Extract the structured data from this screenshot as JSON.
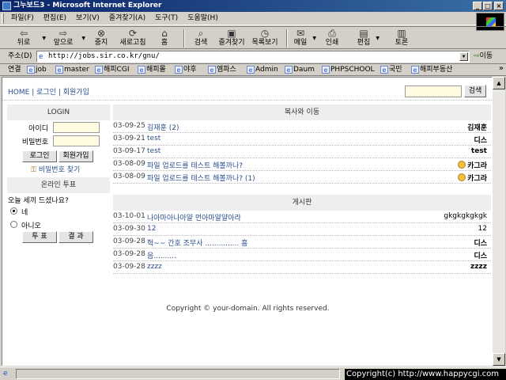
{
  "window": {
    "title": "그누보드3 - Microsoft Internet Explorer"
  },
  "menu": [
    "파일(F)",
    "편집(E)",
    "보기(V)",
    "즐겨찾기(A)",
    "도구(T)",
    "도움말(H)"
  ],
  "toolbar": {
    "back": "뒤로",
    "forward": "앞으로",
    "stop": "중지",
    "refresh": "새로고침",
    "home": "홈",
    "search": "검색",
    "favorites": "즐겨찾기",
    "history": "목록보기",
    "mail": "메일",
    "print": "인쇄",
    "edit": "편집",
    "discuss": "토론"
  },
  "address": {
    "label": "주소(D)",
    "url": "http://jobs.sir.co.kr/gnu/",
    "go": "이동"
  },
  "links": {
    "label": "연결",
    "items": [
      "job",
      "master",
      "해피CGI",
      "해피몰",
      "야후",
      "엠파스",
      "Admin",
      "Daum",
      "PHPSCHOOL",
      "국민",
      "해피부동산"
    ]
  },
  "page": {
    "nav": {
      "home": "HOME",
      "login": "로그인",
      "join": "회원가입",
      "sep": "|"
    },
    "search": {
      "button": "검색",
      "placeholder": ""
    },
    "login": {
      "title": "LOGIN",
      "id_label": "아이디",
      "pw_label": "비밀번호",
      "login_btn": "로그인",
      "join_btn": "회원가입",
      "find_pw": "비밀번호 찾기"
    },
    "poll": {
      "title": "온라인 투표",
      "question": "오늘 세끼 드셨나요?",
      "options": [
        "네",
        "아니오"
      ],
      "vote_btn": "투 표",
      "result_btn": "결 과"
    },
    "board1": {
      "title": "복사와 이동",
      "rows": [
        {
          "date": "03-09-25",
          "subject": "김재훈 (2)",
          "author": "김재훈",
          "icon": false
        },
        {
          "date": "03-09-21",
          "subject": "test",
          "author": "디스",
          "icon": false
        },
        {
          "date": "03-09-17",
          "subject": "test",
          "author": "test",
          "icon": false
        },
        {
          "date": "03-08-09",
          "subject": "파일 업로드를 테스트 해볼까나?",
          "author": "카그라",
          "icon": true
        },
        {
          "date": "03-08-09",
          "subject": "파일 업로드를 테스트 해볼까나? (1)",
          "author": "카그라",
          "icon": true
        }
      ]
    },
    "board2": {
      "title": "게시판",
      "rows": [
        {
          "date": "03-10-01",
          "subject": "나아마아나아얄 먼아마얄얄아라",
          "author": "gkgkgkgkgk",
          "bold": false
        },
        {
          "date": "03-09-30",
          "subject": "12",
          "author": "12",
          "bold": false
        },
        {
          "date": "03-09-28",
          "subject": "헉~~ 간호 조무사 ............... 흠",
          "author": "디스",
          "bold": true
        },
        {
          "date": "03-09-28",
          "subject": "음..........",
          "author": "디스",
          "bold": true
        },
        {
          "date": "03-09-28",
          "subject": "zzzz",
          "author": "zzzz",
          "bold": true
        }
      ]
    },
    "footer": "Copyright © your-domain. All rights reserved."
  },
  "status": {
    "overlay": "Copyright(c) http://www.happycgi.com"
  }
}
